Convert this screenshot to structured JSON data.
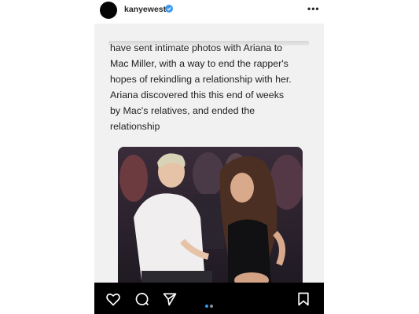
{
  "header": {
    "username": "kanyewest",
    "more_label": "•••"
  },
  "post": {
    "caption_lines": [
      "have sent intimate photos with Ariana to",
      "Mac Miller, with a way to end the rapper's",
      "hopes of rekindling a relationship with her.",
      "Ariana discovered this this end of weeks",
      "by Mac's relatives, and ended the",
      "relationship"
    ],
    "photo_subject": "couple-seated-photo"
  },
  "actions": {
    "icons": [
      "heart-icon",
      "comment-icon",
      "share-icon",
      "bookmark-icon"
    ],
    "carousel_total": 2,
    "carousel_active": 1
  },
  "colors": {
    "verified": "#3897f0",
    "active_dot": "#3897f0",
    "inactive_dot": "#8e8e8e",
    "action_bar": "#000000"
  }
}
